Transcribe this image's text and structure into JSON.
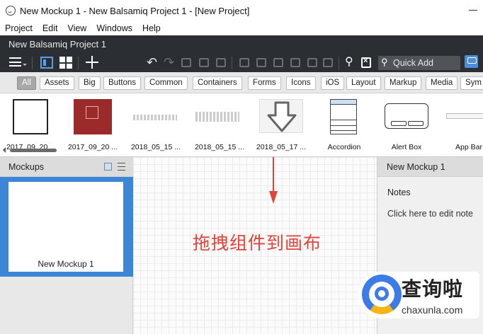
{
  "window": {
    "title": "New Mockup 1 - New Balsamiq Project 1 - [New Project]"
  },
  "menu": {
    "items": [
      "Project",
      "Edit",
      "View",
      "Windows",
      "Help"
    ]
  },
  "project": {
    "title": "New Balsamiq Project 1",
    "quick_add_placeholder": "Quick Add"
  },
  "categories": {
    "items": [
      "All",
      "Assets",
      "Big",
      "Buttons",
      "Common",
      "Containers",
      "Forms",
      "Icons",
      "iOS",
      "Layout",
      "Markup",
      "Media",
      "Sym"
    ],
    "active": "All"
  },
  "components": {
    "items": [
      "2017_09_20 ...",
      "2017_09_20 ...",
      "2018_05_15 ...",
      "2018_05_15 ...",
      "2018_05_17 ...",
      "Accordion",
      "Alert Box",
      "App Bar"
    ]
  },
  "mockups_panel": {
    "title": "Mockups",
    "items": [
      "New Mockup 1"
    ]
  },
  "canvas": {
    "instruction": "拖拽组件到画布",
    "accent_color": "#e0443a"
  },
  "inspector": {
    "title": "New Mockup 1",
    "notes_label": "Notes",
    "notes_placeholder": "Click here to edit note"
  },
  "watermark": {
    "brand_cn": "查询啦",
    "brand_url": "chaxunla.com"
  },
  "colors": {
    "dark_bar": "#2b2e33",
    "selection_blue": "#3d86d6"
  }
}
